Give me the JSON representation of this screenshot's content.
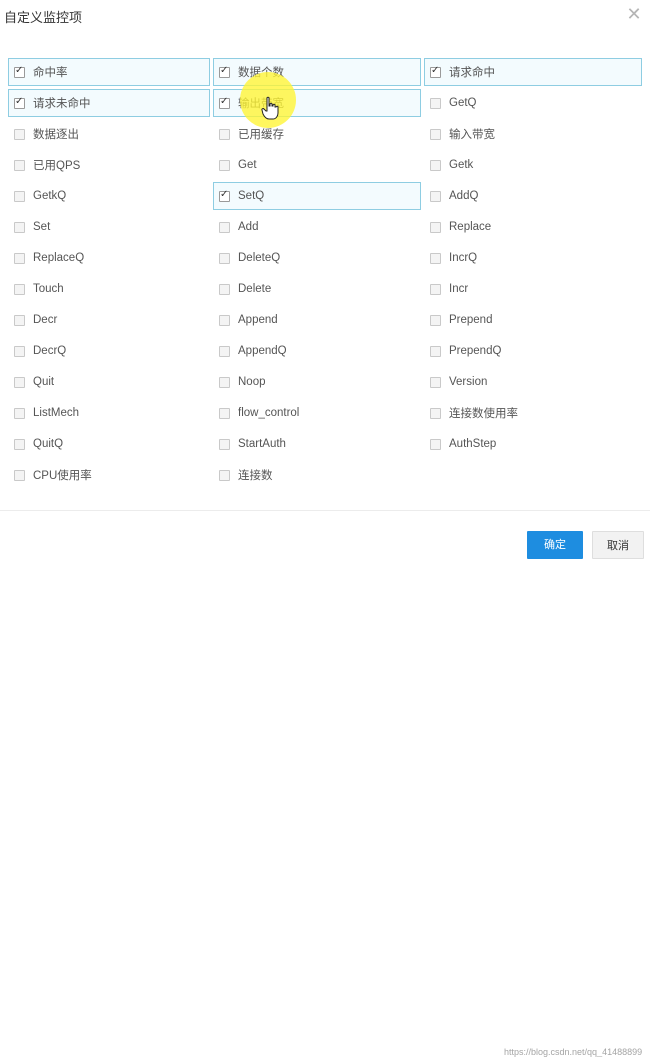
{
  "dialog": {
    "title": "自定义监控项",
    "close_icon": "close-icon"
  },
  "items": [
    {
      "label": "命中率",
      "checked": true
    },
    {
      "label": "数据个数",
      "checked": true
    },
    {
      "label": "请求命中",
      "checked": true
    },
    {
      "label": "请求未命中",
      "checked": true
    },
    {
      "label": "输出带宽",
      "checked": true
    },
    {
      "label": "GetQ",
      "checked": false
    },
    {
      "label": "数据逐出",
      "checked": false
    },
    {
      "label": "已用缓存",
      "checked": false
    },
    {
      "label": "输入带宽",
      "checked": false
    },
    {
      "label": "已用QPS",
      "checked": false
    },
    {
      "label": "Get",
      "checked": false
    },
    {
      "label": "Getk",
      "checked": false
    },
    {
      "label": "GetkQ",
      "checked": false
    },
    {
      "label": "SetQ",
      "checked": true
    },
    {
      "label": "AddQ",
      "checked": false
    },
    {
      "label": "Set",
      "checked": false
    },
    {
      "label": "Add",
      "checked": false
    },
    {
      "label": "Replace",
      "checked": false
    },
    {
      "label": "ReplaceQ",
      "checked": false
    },
    {
      "label": "DeleteQ",
      "checked": false
    },
    {
      "label": "IncrQ",
      "checked": false
    },
    {
      "label": "Touch",
      "checked": false
    },
    {
      "label": "Delete",
      "checked": false
    },
    {
      "label": "Incr",
      "checked": false
    },
    {
      "label": "Decr",
      "checked": false
    },
    {
      "label": "Append",
      "checked": false
    },
    {
      "label": "Prepend",
      "checked": false
    },
    {
      "label": "DecrQ",
      "checked": false
    },
    {
      "label": "AppendQ",
      "checked": false
    },
    {
      "label": "PrependQ",
      "checked": false
    },
    {
      "label": "Quit",
      "checked": false
    },
    {
      "label": "Noop",
      "checked": false
    },
    {
      "label": "Version",
      "checked": false
    },
    {
      "label": "ListMech",
      "checked": false
    },
    {
      "label": "flow_control",
      "checked": false
    },
    {
      "label": "连接数使用率",
      "checked": false
    },
    {
      "label": "QuitQ",
      "checked": false
    },
    {
      "label": "StartAuth",
      "checked": false
    },
    {
      "label": "AuthStep",
      "checked": false
    },
    {
      "label": "CPU使用率",
      "checked": false
    },
    {
      "label": "连接数",
      "checked": false
    }
  ],
  "footer": {
    "ok_label": "确定",
    "cancel_label": "取消",
    "watermark": "https://blog.csdn.net/qq_41488899"
  },
  "colors": {
    "primary": "#1e8de0",
    "checked_border": "#8ecde2",
    "checked_bg": "#f3fbfe",
    "cursor_highlight": "#fff532"
  }
}
